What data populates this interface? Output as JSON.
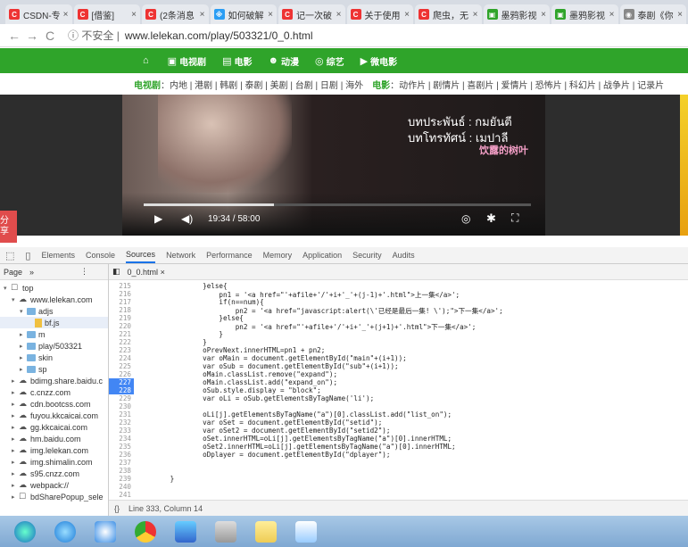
{
  "browser": {
    "tabs": [
      {
        "title": "CSDN-专",
        "fav": "C",
        "color": "#e33"
      },
      {
        "title": "[借鉴]",
        "fav": "C",
        "color": "#e33"
      },
      {
        "title": "(2条消息",
        "fav": "C",
        "color": "#e33"
      },
      {
        "title": "如何破解",
        "fav": "※",
        "color": "#2a9df4"
      },
      {
        "title": "记一次破",
        "fav": "C",
        "color": "#e33"
      },
      {
        "title": "关于使用",
        "fav": "C",
        "color": "#e33"
      },
      {
        "title": "爬虫，无",
        "fav": "C",
        "color": "#e33"
      },
      {
        "title": "墨鸦影视",
        "fav": "▣",
        "color": "#2fa42a"
      },
      {
        "title": "墨鸦影视",
        "fav": "▣",
        "color": "#2fa42a"
      },
      {
        "title": "泰剧《你",
        "fav": "◉",
        "color": "#888"
      }
    ],
    "security_label": "不安全",
    "url": "www.lelekan.com/play/503321/0_0.html"
  },
  "site": {
    "nav": [
      {
        "icon": "home-icon",
        "label": ""
      },
      {
        "icon": "tv-icon",
        "label": "电视剧"
      },
      {
        "icon": "film-icon",
        "label": "电影"
      },
      {
        "icon": "anime-icon",
        "label": "动漫"
      },
      {
        "icon": "variety-icon",
        "label": "综艺"
      },
      {
        "icon": "micro-film-icon",
        "label": "微电影"
      }
    ],
    "subnav_tv_label": "电视剧",
    "subnav_tv": "：内地 | 港剧 | 韩剧 | 泰剧 | 美剧 | 台剧 | 日剧 | 海外",
    "subnav_movie_label": "电影",
    "subnav_movie": "：动作片 | 剧情片 | 喜剧片 | 爱情片 | 恐怖片 | 科幻片 | 战争片 | 记录片",
    "share_label": "分享"
  },
  "video": {
    "thai_line1": "บทประพันธ์ : กมยันตี",
    "thai_line2": "บทโทรทัศน์ : เมปาลี",
    "watermark": "饮露的树叶",
    "current_time": "19:34",
    "duration": "58:00",
    "progress": 0.337
  },
  "devtools": {
    "tabs": [
      "Elements",
      "Console",
      "Sources",
      "Network",
      "Performance",
      "Memory",
      "Application",
      "Security",
      "Audits"
    ],
    "active_tab": "Sources",
    "navigator_label": "Page",
    "tree": [
      {
        "indent": 0,
        "tri": "▾",
        "kind": "frame",
        "label": "top"
      },
      {
        "indent": 1,
        "tri": "▾",
        "kind": "cloud",
        "label": "www.lelekan.com"
      },
      {
        "indent": 2,
        "tri": "▾",
        "kind": "folder",
        "label": "adjs"
      },
      {
        "indent": 3,
        "tri": "",
        "kind": "file",
        "label": "bf.js"
      },
      {
        "indent": 2,
        "tri": "▸",
        "kind": "folder",
        "label": "m"
      },
      {
        "indent": 2,
        "tri": "▸",
        "kind": "folder",
        "label": "play/503321"
      },
      {
        "indent": 2,
        "tri": "▸",
        "kind": "folder",
        "label": "skin"
      },
      {
        "indent": 2,
        "tri": "▸",
        "kind": "folder",
        "label": "sp"
      },
      {
        "indent": 1,
        "tri": "▸",
        "kind": "cloud",
        "label": "bdimg.share.baidu.c"
      },
      {
        "indent": 1,
        "tri": "▸",
        "kind": "cloud",
        "label": "c.cnzz.com"
      },
      {
        "indent": 1,
        "tri": "▸",
        "kind": "cloud",
        "label": "cdn.bootcss.com"
      },
      {
        "indent": 1,
        "tri": "▸",
        "kind": "cloud",
        "label": "fuyou.kkcaicai.com"
      },
      {
        "indent": 1,
        "tri": "▸",
        "kind": "cloud",
        "label": "gg.kkcaicai.com"
      },
      {
        "indent": 1,
        "tri": "▸",
        "kind": "cloud",
        "label": "hm.baidu.com"
      },
      {
        "indent": 1,
        "tri": "▸",
        "kind": "cloud",
        "label": "img.lelekan.com"
      },
      {
        "indent": 1,
        "tri": "▸",
        "kind": "cloud",
        "label": "img.shimalin.com"
      },
      {
        "indent": 1,
        "tri": "▸",
        "kind": "cloud",
        "label": "s95.cnzz.com"
      },
      {
        "indent": 1,
        "tri": "▸",
        "kind": "cloud",
        "label": "webpack://"
      },
      {
        "indent": 1,
        "tri": "▸",
        "kind": "frame",
        "label": "bdSharePopup_sele"
      }
    ],
    "open_file": "0_0.html",
    "code": [
      {
        "n": "215",
        "t": "                }else{"
      },
      {
        "n": "216",
        "t": "                    pn1 = '<a href=\"'+afile+'/'+i+'_'+(j-1)+'.html\">上一集</a>';"
      },
      {
        "n": "217",
        "t": "                    if(n==num){"
      },
      {
        "n": "218",
        "t": "                        pn2 = '<a href=\"javascript:alert(\\'已经是最后一集! \\');\">下一集</a>';"
      },
      {
        "n": "219",
        "t": "                    }else{"
      },
      {
        "n": "220",
        "t": "                        pn2 = '<a href=\"'+afile+'/'+i+'_'+(j+1)+'.html\">下一集</a>';"
      },
      {
        "n": "221",
        "t": "                    }"
      },
      {
        "n": "222",
        "t": "                }"
      },
      {
        "n": "223",
        "t": "                oPrevNext.innerHTML=pn1 + pn2;"
      },
      {
        "n": "224",
        "t": "                var oMain = document.getElementById(\"main\"+(i+1));"
      },
      {
        "n": "225",
        "t": "                var oSub = document.getElementById(\"sub\"+(i+1));"
      },
      {
        "n": "226",
        "t": "                oMain.classList.remove(\"expand\");"
      },
      {
        "n": "227",
        "t": "                oMain.classList.add(\"expand_on\");"
      },
      {
        "n": "228",
        "t": "                oSub.style.display = \"block\";"
      },
      {
        "n": "229",
        "t": "                var oLi = oSub.getElementsByTagName('li');"
      },
      {
        "n": "230",
        "t": ""
      },
      {
        "n": "231",
        "t": "                oLi[j].getElementsByTagName(\"a\")[0].classList.add(\"list_on\");"
      },
      {
        "n": "232",
        "t": "                var oSet = document.getElementById(\"setid\");"
      },
      {
        "n": "233",
        "t": "                var oSet2 = document.getElementById(\"setid2\");"
      },
      {
        "n": "234",
        "t": "                oSet.innerHTML=oLi[j].getElementsByTagName(\"a\")[0].innerHTML;"
      },
      {
        "n": "235",
        "t": "                oSet2.innerHTML=oLi[j].getElementsByTagName(\"a\")[0].innerHTML;"
      },
      {
        "n": "236",
        "t": "                oDplayer = document.getElementById(\"dplayer\");"
      },
      {
        "n": "237",
        "t": ""
      },
      {
        "n": "238",
        "t": ""
      },
      {
        "n": "239",
        "t": "        }"
      },
      {
        "n": "240",
        "t": ""
      },
      {
        "n": "241",
        "t": ""
      }
    ],
    "breakpoints": [
      "227",
      "228"
    ],
    "status": "Line 333, Column 14",
    "status_icon": "{}"
  },
  "taskbar": {
    "items": [
      "start-orb-icon",
      "ie-icon",
      "baidu-netdisk-icon",
      "chrome-icon",
      "media-player-icon",
      "calculator-icon",
      "explorer-folder-icon",
      "download-icon"
    ]
  }
}
